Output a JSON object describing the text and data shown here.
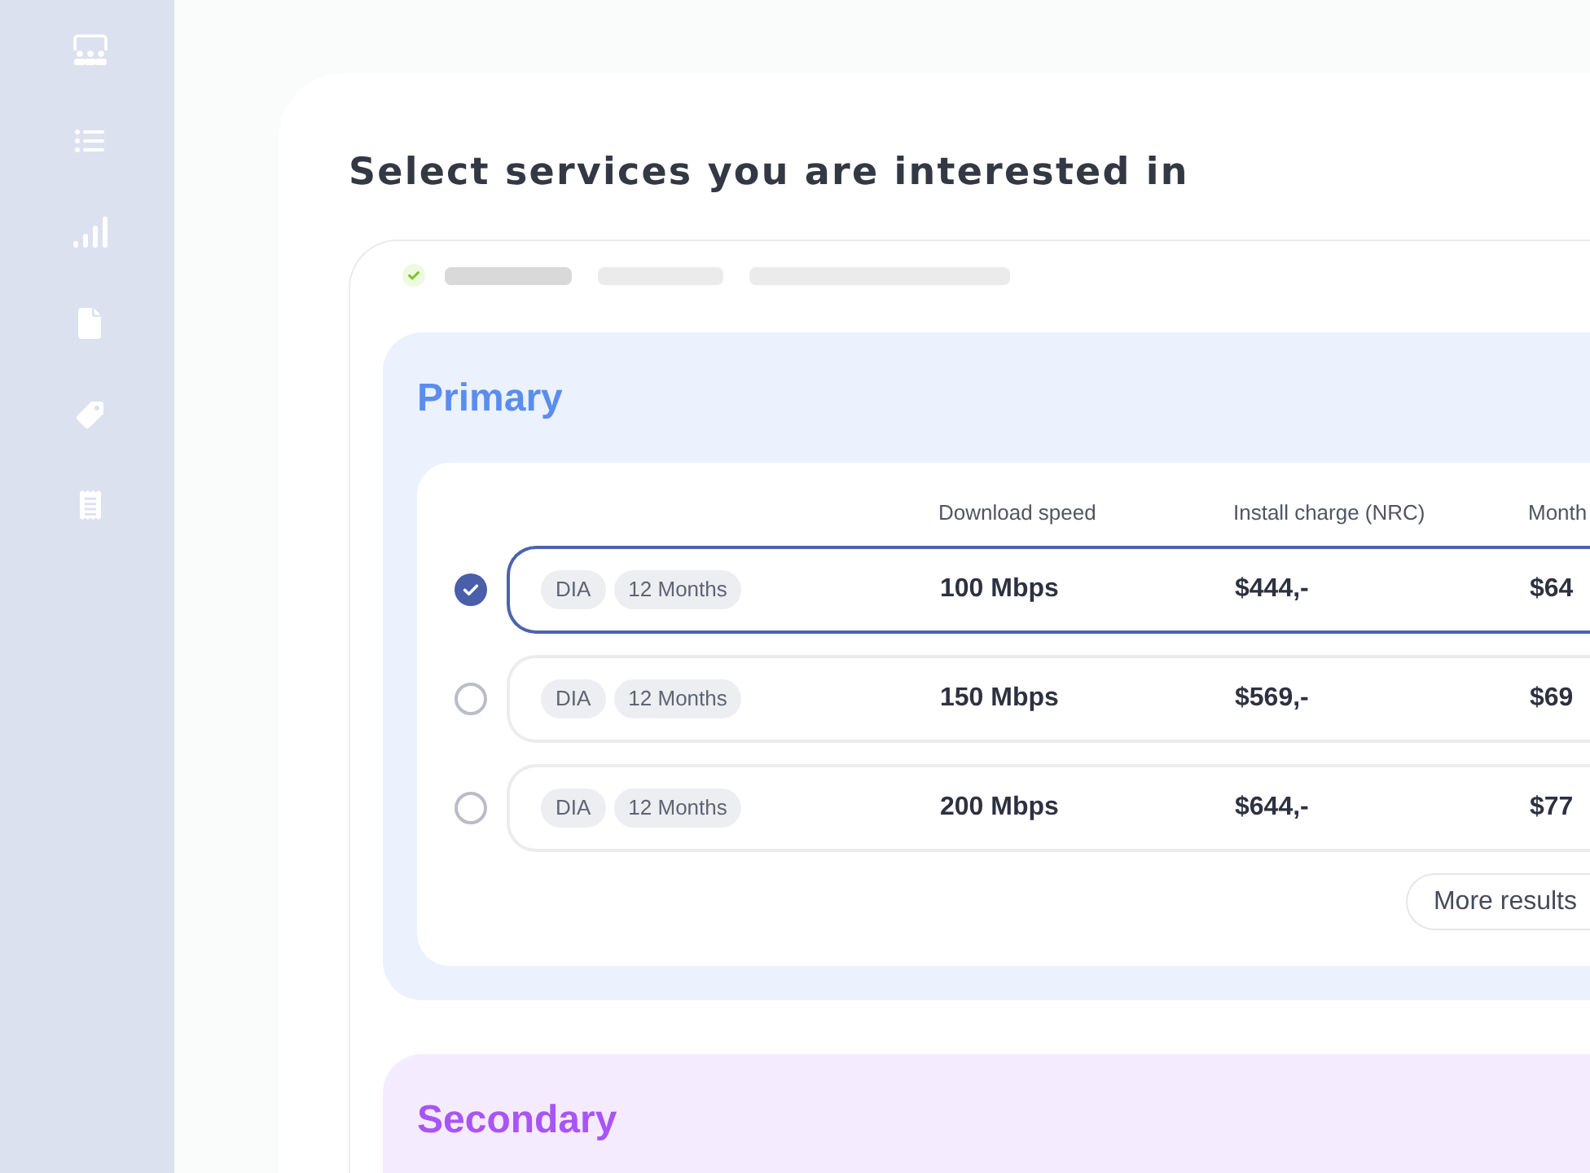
{
  "title": "Select services you are interested in",
  "sections": [
    {
      "title": "Primary",
      "color": "#5b8def",
      "table": {
        "columns": [
          "Download speed",
          "Install charge (NRC)",
          "Month"
        ],
        "rows": [
          {
            "selected": true,
            "tags": [
              "DIA",
              "12 Months"
            ],
            "cells": [
              "100 Mbps",
              "$444,-",
              "$64"
            ]
          },
          {
            "selected": false,
            "tags": [
              "DIA",
              "12 Months"
            ],
            "cells": [
              "150 Mbps",
              "$569,-",
              "$69"
            ]
          },
          {
            "selected": false,
            "tags": [
              "DIA",
              "12 Months"
            ],
            "cells": [
              "200 Mbps",
              "$644,-",
              "$77"
            ]
          }
        ]
      },
      "more_button": "More results"
    },
    {
      "title": "Secondary",
      "color": "#a855f7"
    }
  ]
}
